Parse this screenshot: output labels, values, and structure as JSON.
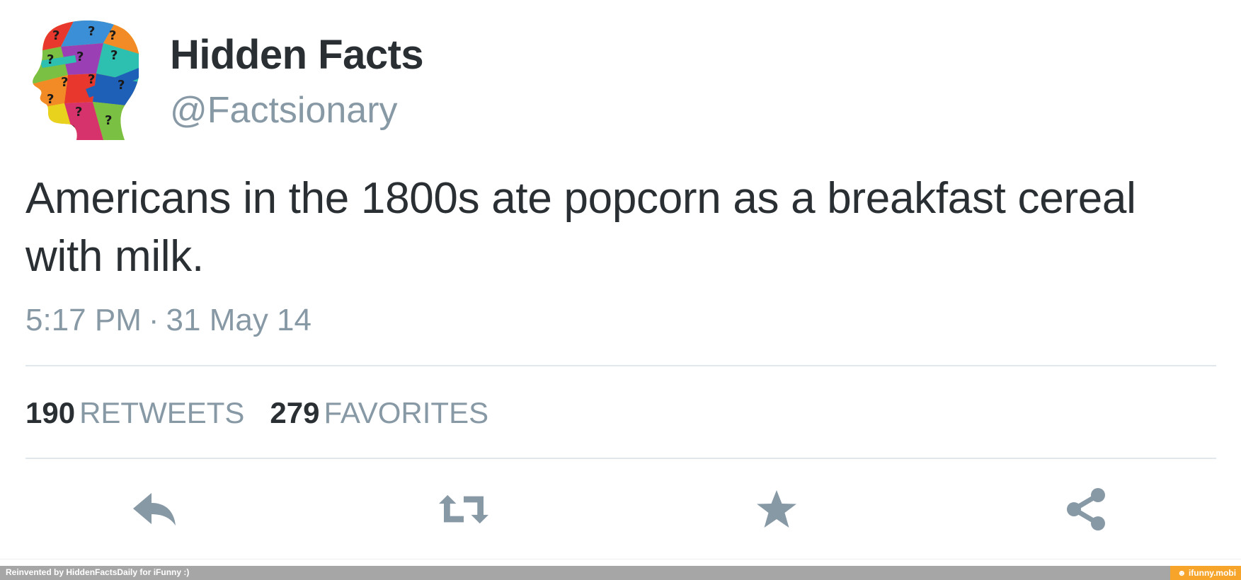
{
  "user": {
    "display_name": "Hidden Facts",
    "handle": "@Factsionary",
    "avatar_icon": "colorful-head-question-marks-icon"
  },
  "tweet": {
    "text_line1": "Americans in the 1800s ate popcorn as a breakfast cereal",
    "text_line2": "with milk.",
    "time": "5:17 PM",
    "separator": "·",
    "date": "31 May 14"
  },
  "stats": {
    "retweets_count": "190",
    "retweets_label": "RETWEETS",
    "favorites_count": "279",
    "favorites_label": "FAVORITES"
  },
  "actions": [
    {
      "name": "reply",
      "icon": "reply-icon"
    },
    {
      "name": "retweet",
      "icon": "retweet-icon"
    },
    {
      "name": "favorite",
      "icon": "star-icon"
    },
    {
      "name": "share",
      "icon": "share-icon"
    }
  ],
  "footer": {
    "credit": "Reinvented by HiddenFactsDaily for iFunny :)",
    "brand": "ifunny.mobi"
  },
  "colors": {
    "text": "#292f33",
    "muted": "#8899a6",
    "icon": "#8899a6",
    "divider": "#e1e8ed",
    "footer_bar": "#a6a6a6",
    "footer_brand": "#f7a42b"
  }
}
